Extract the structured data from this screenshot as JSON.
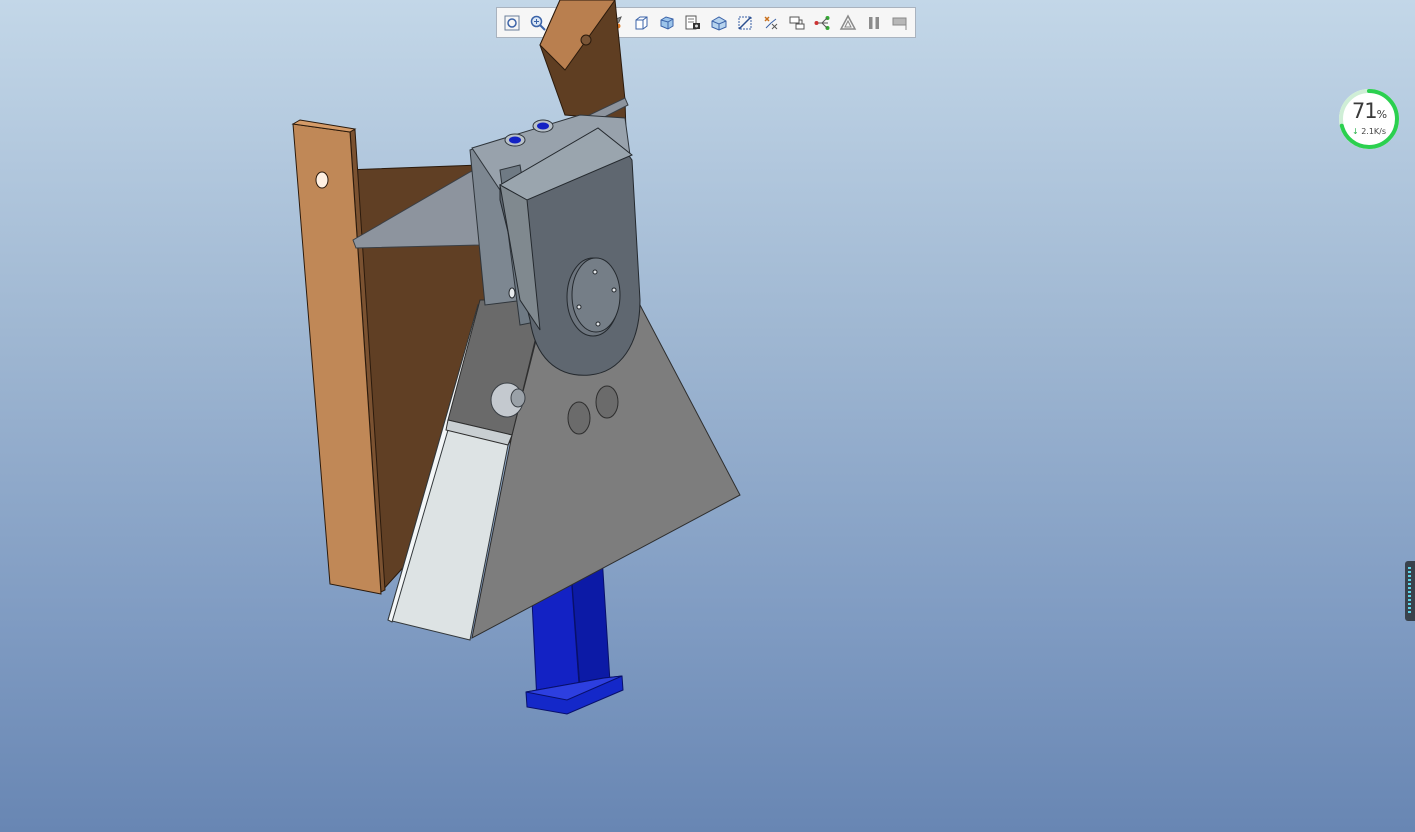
{
  "toolbar": {
    "buttons": [
      {
        "name": "zoom-fit-icon"
      },
      {
        "name": "zoom-in-icon"
      },
      {
        "name": "zoom-out-icon"
      },
      {
        "name": "repaint-icon"
      },
      {
        "name": "spin-center-icon"
      },
      {
        "name": "saved-orientations-icon"
      },
      {
        "name": "display-style-icon"
      },
      {
        "name": "view-manager-icon"
      },
      {
        "name": "perspective-icon"
      },
      {
        "name": "datum-planes-icon"
      },
      {
        "name": "datum-points-icon"
      },
      {
        "name": "annotation-display-icon"
      },
      {
        "name": "datum-axes-icon"
      },
      {
        "name": "triangle-filter-icon"
      },
      {
        "name": "pause-icon"
      },
      {
        "name": "dimension-flag-icon"
      }
    ]
  },
  "net_meter": {
    "percent": "71",
    "percent_sign": "%",
    "speed": "2.1K/s",
    "value": 0.71,
    "ring_color": "#2bd04f"
  },
  "colors": {
    "wood": "#c08857",
    "wood_dark": "#5f3e22",
    "steel": "#8a9099",
    "blue": "#0d1fc4"
  }
}
